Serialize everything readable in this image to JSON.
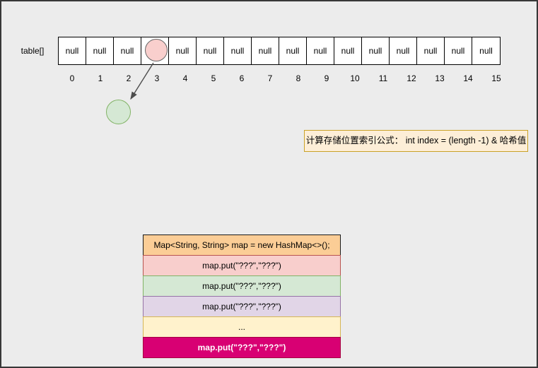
{
  "canvas": {
    "background": "#ececec",
    "frame_color": "#383838"
  },
  "hash_table": {
    "label": "table[]",
    "cells": [
      "null",
      "null",
      "null",
      "",
      "null",
      "null",
      "null",
      "null",
      "null",
      "null",
      "null",
      "null",
      "null",
      "null",
      "null",
      "null"
    ],
    "indexes": [
      "0",
      "1",
      "2",
      "3",
      "4",
      "5",
      "6",
      "7",
      "8",
      "9",
      "10",
      "11",
      "12",
      "13",
      "14",
      "15"
    ],
    "occupied_index": "3",
    "cell_fill": "#ffffff",
    "cell_border": "#000000",
    "entry_circle": {
      "fill": "#f9cfcd",
      "border": "#666666"
    },
    "node_circle": {
      "fill": "#d5e8d4",
      "border": "#82b366"
    },
    "arrow_color": "#4d4d4d"
  },
  "formula_note": {
    "text": "计算存储位置索引公式： int index = (length -1) & 哈希值",
    "fill": "#fdeed7",
    "border": "#c9a227"
  },
  "code_stack": {
    "rows": [
      {
        "text": "Map<String, String> map = new HashMap<>();",
        "fill": "#fbcd96",
        "border": "#1a1a1a",
        "color": "#000000",
        "bold": false
      },
      {
        "text": "map.put(\"???\",\"???\")",
        "fill": "#f8cecc",
        "border": "#b85450",
        "color": "#000000",
        "bold": false
      },
      {
        "text": "map.put(\"???\",\"???\")",
        "fill": "#d5e8d4",
        "border": "#82b366",
        "color": "#000000",
        "bold": false
      },
      {
        "text": "map.put(\"???\",\"???\")",
        "fill": "#e1d5e7",
        "border": "#9673a6",
        "color": "#000000",
        "bold": false
      },
      {
        "text": "...",
        "fill": "#fff2cc",
        "border": "#d6b656",
        "color": "#000000",
        "bold": false
      },
      {
        "text": "map.put(\"???\",\"???\")",
        "fill": "#d80073",
        "border": "#a50040",
        "color": "#ffffff",
        "bold": true
      }
    ]
  }
}
